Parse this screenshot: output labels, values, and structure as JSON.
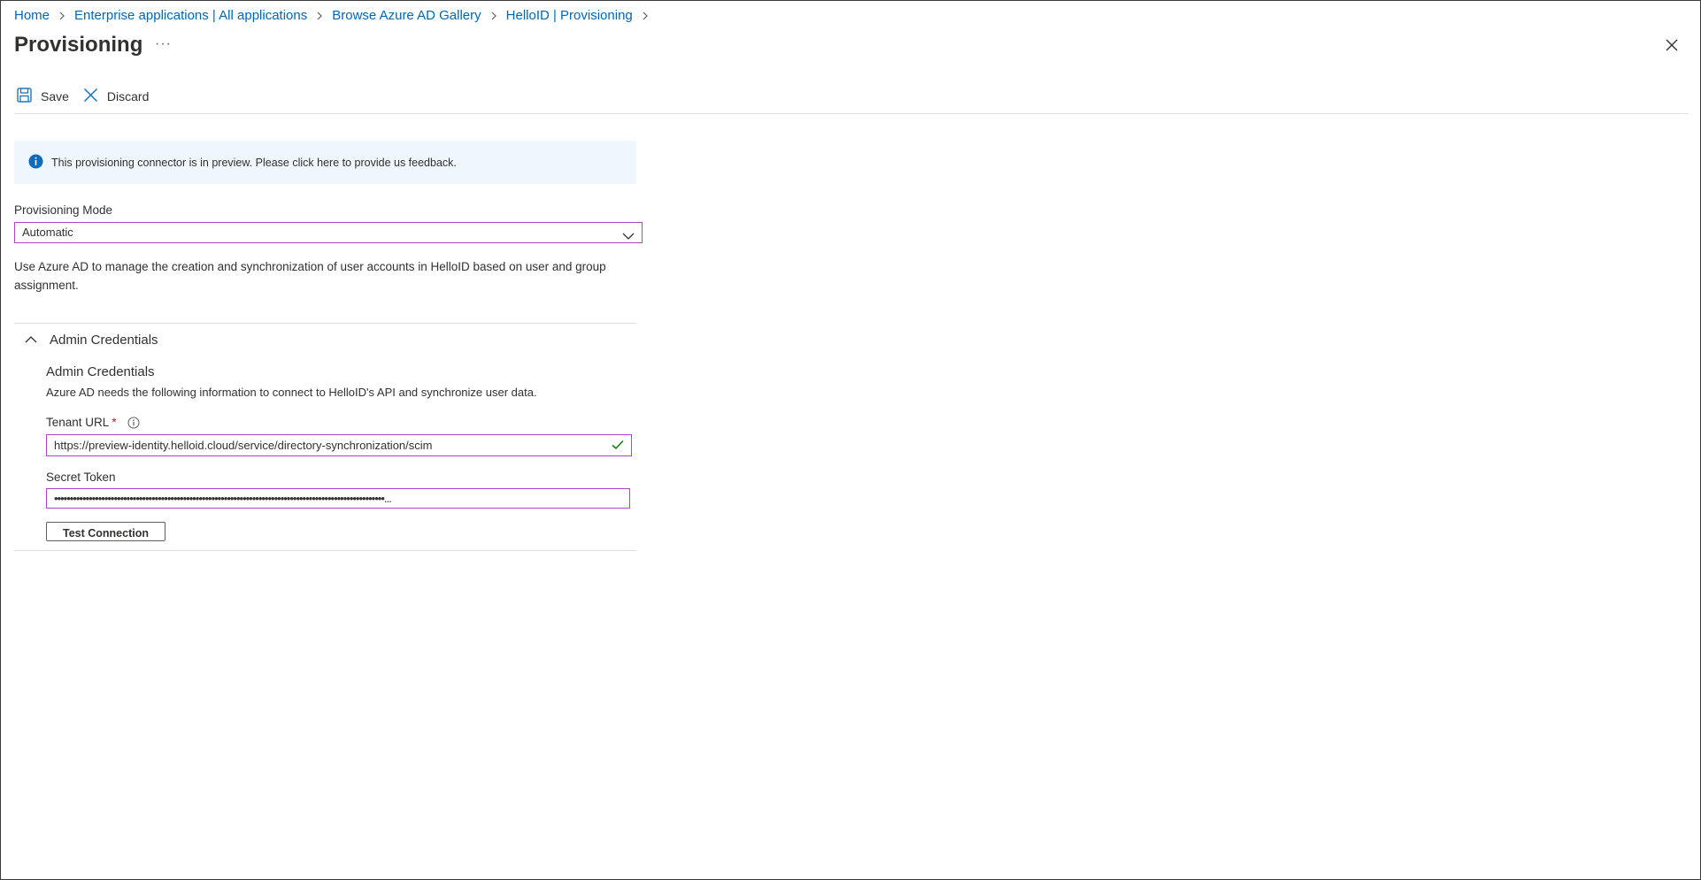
{
  "breadcrumb": {
    "items": [
      {
        "label": "Home"
      },
      {
        "label": "Enterprise applications | All applications"
      },
      {
        "label": "Browse Azure AD Gallery"
      },
      {
        "label": "HelloID | Provisioning"
      }
    ]
  },
  "header": {
    "title": "Provisioning",
    "more_label": "···"
  },
  "toolbar": {
    "save_label": "Save",
    "discard_label": "Discard"
  },
  "banner": {
    "text": "This provisioning connector is in preview. Please click here to provide us feedback."
  },
  "provisioning_mode": {
    "label": "Provisioning Mode",
    "selected": "Automatic",
    "description": "Use Azure AD to manage the creation and synchronization of user accounts in HelloID based on user and group assignment."
  },
  "admin_credentials": {
    "section_label": "Admin Credentials",
    "title": "Admin Credentials",
    "description": "Azure AD needs the following information to connect to HelloID's API and synchronize user data.",
    "tenant_url_label": "Tenant URL",
    "required_mark": "*",
    "tenant_url_value": "https://preview-identity.helloid.cloud/service/directory-synchronization/scim",
    "secret_token_label": "Secret Token",
    "secret_token_value": "•••••••••••••••••••••••••••••••••••••••••••••••••••••••••••••••••••••••••••••••••••••••••••••••••••••••••...",
    "test_button_label": "Test Connection"
  },
  "colors": {
    "link": "#0067b8",
    "focus_border": "#b042c6",
    "banner_bg": "#eff6fc",
    "info_icon": "#0f6cbd",
    "valid_check": "#107c10",
    "required": "#a4262c"
  },
  "icons": {
    "chevron_right": "chevron-right-icon",
    "close": "close-icon",
    "save": "save-icon",
    "discard": "discard-x-icon",
    "info": "info-icon",
    "dropdown": "chevron-down-icon",
    "collapse": "chevron-up-icon",
    "tooltip": "info-circle-icon",
    "valid": "checkmark-icon"
  }
}
